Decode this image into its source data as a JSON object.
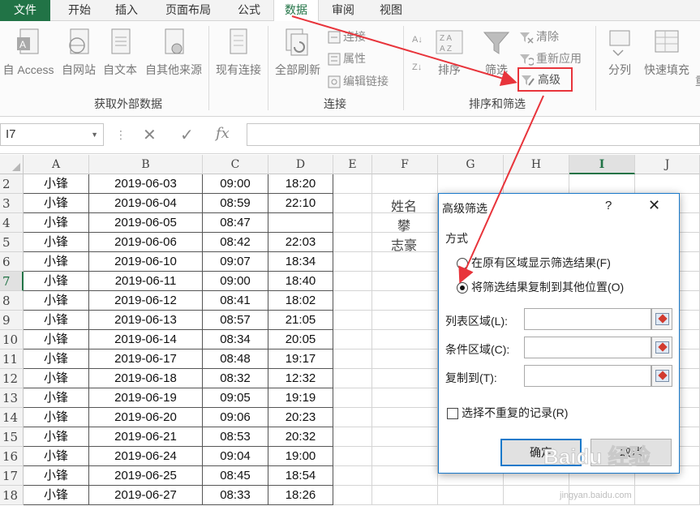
{
  "ribbon_tabs": [
    "文件",
    "开始",
    "插入",
    "页面布局",
    "公式",
    "数据",
    "审阅",
    "视图"
  ],
  "active_tab": "数据",
  "ribbon": {
    "get_external": {
      "buttons": [
        "自 Access",
        "自网站",
        "自文本",
        "自其他来源"
      ],
      "label": "获取外部数据"
    },
    "existing_connections": "现有连接",
    "connections": {
      "refresh_all": "全部刷新",
      "small": [
        "连接",
        "属性",
        "编辑链接"
      ],
      "label": "连接"
    },
    "sort_filter": {
      "sort": "排序",
      "filter": "筛选",
      "clear": "清除",
      "reapply": "重新应用",
      "advanced": "高级",
      "label": "排序和筛选"
    },
    "data_tools": {
      "split": "分列",
      "flash_fill": "快速填充",
      "partial": "重"
    }
  },
  "formula_bar": {
    "name_box": "I7",
    "fx": "fx"
  },
  "grid": {
    "columns": [
      "A",
      "B",
      "C",
      "D",
      "E",
      "F",
      "G",
      "H",
      "I",
      "J"
    ],
    "selected_column": "I",
    "selected_row": "7",
    "rows": [
      {
        "num": "2",
        "a": "小锋",
        "b": "2019-06-03",
        "c": "09:00",
        "d": "18:20"
      },
      {
        "num": "3",
        "a": "小锋",
        "b": "2019-06-04",
        "c": "08:59",
        "d": "22:10"
      },
      {
        "num": "4",
        "a": "小锋",
        "b": "2019-06-05",
        "c": "08:47",
        "d": ""
      },
      {
        "num": "5",
        "a": "小锋",
        "b": "2019-06-06",
        "c": "08:42",
        "d": "22:03"
      },
      {
        "num": "6",
        "a": "小锋",
        "b": "2019-06-10",
        "c": "09:07",
        "d": "18:34"
      },
      {
        "num": "7",
        "a": "小锋",
        "b": "2019-06-11",
        "c": "09:00",
        "d": "18:40"
      },
      {
        "num": "8",
        "a": "小锋",
        "b": "2019-06-12",
        "c": "08:41",
        "d": "18:02"
      },
      {
        "num": "9",
        "a": "小锋",
        "b": "2019-06-13",
        "c": "08:57",
        "d": "21:05"
      },
      {
        "num": "10",
        "a": "小锋",
        "b": "2019-06-14",
        "c": "08:34",
        "d": "20:05"
      },
      {
        "num": "11",
        "a": "小锋",
        "b": "2019-06-17",
        "c": "08:48",
        "d": "19:17"
      },
      {
        "num": "12",
        "a": "小锋",
        "b": "2019-06-18",
        "c": "08:32",
        "d": "12:32"
      },
      {
        "num": "13",
        "a": "小锋",
        "b": "2019-06-19",
        "c": "09:05",
        "d": "19:19"
      },
      {
        "num": "14",
        "a": "小锋",
        "b": "2019-06-20",
        "c": "09:06",
        "d": "20:23"
      },
      {
        "num": "15",
        "a": "小锋",
        "b": "2019-06-21",
        "c": "08:53",
        "d": "20:32"
      },
      {
        "num": "16",
        "a": "小锋",
        "b": "2019-06-24",
        "c": "09:04",
        "d": "19:00"
      },
      {
        "num": "17",
        "a": "小锋",
        "b": "2019-06-25",
        "c": "08:45",
        "d": "18:54"
      },
      {
        "num": "18",
        "a": "小锋",
        "b": "2019-06-27",
        "c": "08:33",
        "d": "18:26"
      }
    ],
    "f_column": [
      "姓名",
      "攀",
      "志豪"
    ]
  },
  "dialog": {
    "title": "高级筛选",
    "help": "?",
    "close": "✕",
    "section": "方式",
    "option1": "在原有区域显示筛选结果(F)",
    "option2": "将筛选结果复制到其他位置(O)",
    "selected_option": 2,
    "list_range_label": "列表区域(L):",
    "criteria_range_label": "条件区域(C):",
    "copy_to_label": "复制到(T):",
    "list_range_value": "",
    "criteria_range_value": "",
    "copy_to_value": "",
    "unique_label": "选择不重复的记录(R)",
    "unique_checked": false,
    "ok": "确定",
    "cancel": "取消"
  },
  "watermark": {
    "text": "Baidu 经验",
    "url": "jingyan.baidu.com"
  },
  "colors": {
    "excel_green": "#217346",
    "annotation_red": "#e8343b",
    "dialog_border": "#1979ca"
  }
}
